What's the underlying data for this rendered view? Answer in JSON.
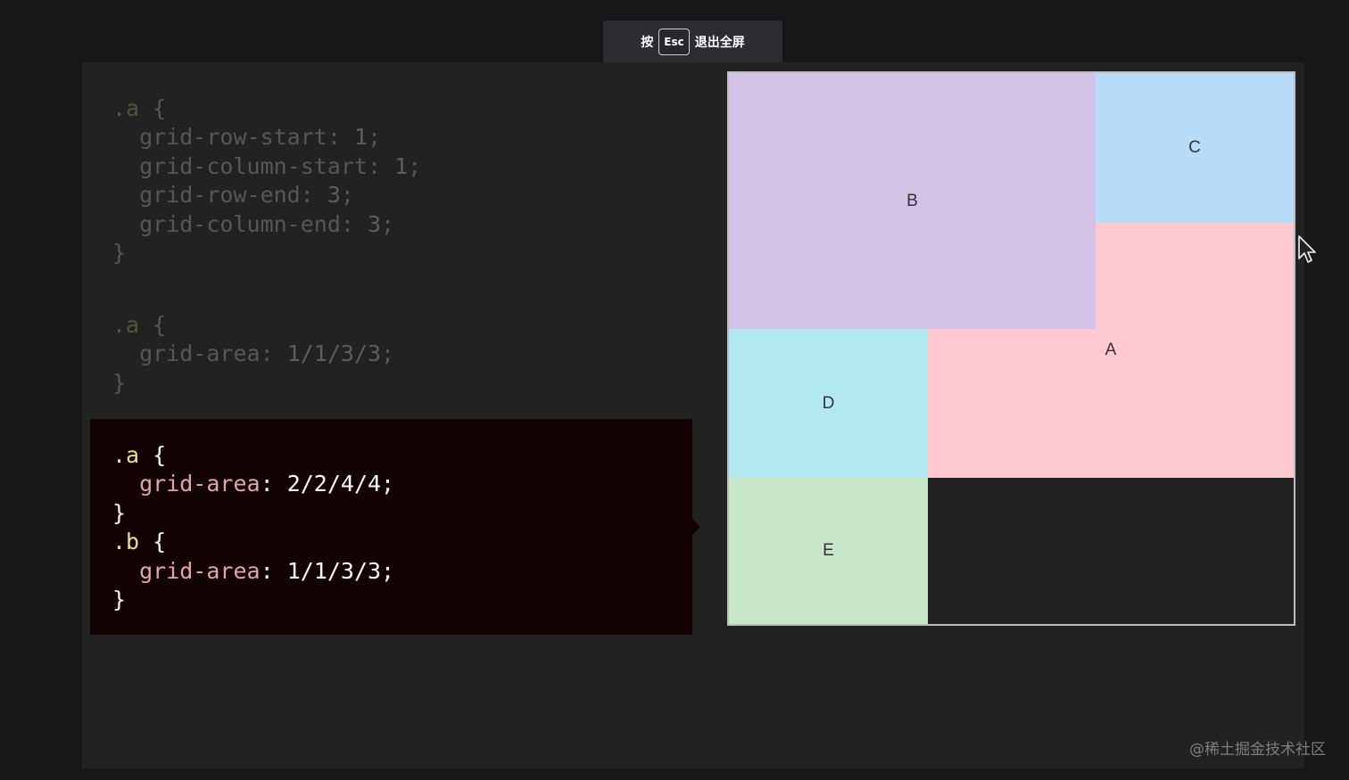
{
  "fullscreen_bar": {
    "prefix": "按",
    "key": "Esc",
    "suffix": "退出全屏"
  },
  "code_blocks": {
    "block1": {
      "lines": [
        [
          {
            "t": ".a",
            "c": "sel"
          },
          {
            "t": " {",
            "c": "punc"
          }
        ],
        [
          {
            "t": "  grid-row-start",
            "c": "prop"
          },
          {
            "t": ": ",
            "c": "punc"
          },
          {
            "t": "1",
            "c": "val"
          },
          {
            "t": ";",
            "c": "punc"
          }
        ],
        [
          {
            "t": "  grid-column-start",
            "c": "prop"
          },
          {
            "t": ": ",
            "c": "punc"
          },
          {
            "t": "1",
            "c": "val"
          },
          {
            "t": ";",
            "c": "punc"
          }
        ],
        [
          {
            "t": "  grid-row-end",
            "c": "prop"
          },
          {
            "t": ": ",
            "c": "punc"
          },
          {
            "t": "3",
            "c": "val"
          },
          {
            "t": ";",
            "c": "punc"
          }
        ],
        [
          {
            "t": "  grid-column-end",
            "c": "prop"
          },
          {
            "t": ": ",
            "c": "punc"
          },
          {
            "t": "3",
            "c": "val"
          },
          {
            "t": ";",
            "c": "punc"
          }
        ],
        [
          {
            "t": "}",
            "c": "punc"
          }
        ]
      ]
    },
    "block2": {
      "lines": [
        [
          {
            "t": ".a",
            "c": "sel"
          },
          {
            "t": " {",
            "c": "punc"
          }
        ],
        [
          {
            "t": "  grid-area",
            "c": "prop"
          },
          {
            "t": ": ",
            "c": "punc"
          },
          {
            "t": "1/1/3/3",
            "c": "val"
          },
          {
            "t": ";",
            "c": "punc"
          }
        ],
        [
          {
            "t": "}",
            "c": "punc"
          }
        ]
      ]
    },
    "block3": {
      "lines": [
        [
          {
            "t": ".a",
            "c": "sel"
          },
          {
            "t": " {",
            "c": "punc"
          }
        ],
        [
          {
            "t": "  grid-area",
            "c": "prop"
          },
          {
            "t": ": ",
            "c": "punc"
          },
          {
            "t": "2/2/4/4",
            "c": "val"
          },
          {
            "t": ";",
            "c": "punc"
          }
        ],
        [
          {
            "t": "}",
            "c": "punc"
          }
        ],
        [
          {
            "t": ".b",
            "c": "sel"
          },
          {
            "t": " {",
            "c": "punc"
          }
        ],
        [
          {
            "t": "  grid-area",
            "c": "prop"
          },
          {
            "t": ": ",
            "c": "punc"
          },
          {
            "t": "1/1/3/3",
            "c": "val"
          },
          {
            "t": ";",
            "c": "punc"
          }
        ],
        [
          {
            "t": "}",
            "c": "punc"
          }
        ]
      ]
    }
  },
  "grid_demo": {
    "cells": [
      {
        "label": "B",
        "color": "#d3c2e6"
      },
      {
        "label": "C",
        "color": "#b8dcf8"
      },
      {
        "label": "A",
        "color": "#ffcacf"
      },
      {
        "label": "D",
        "color": "#b2e8f0"
      },
      {
        "label": "E",
        "color": "#c8e6c9"
      }
    ]
  },
  "watermark": "@稀土掘金技术社区"
}
